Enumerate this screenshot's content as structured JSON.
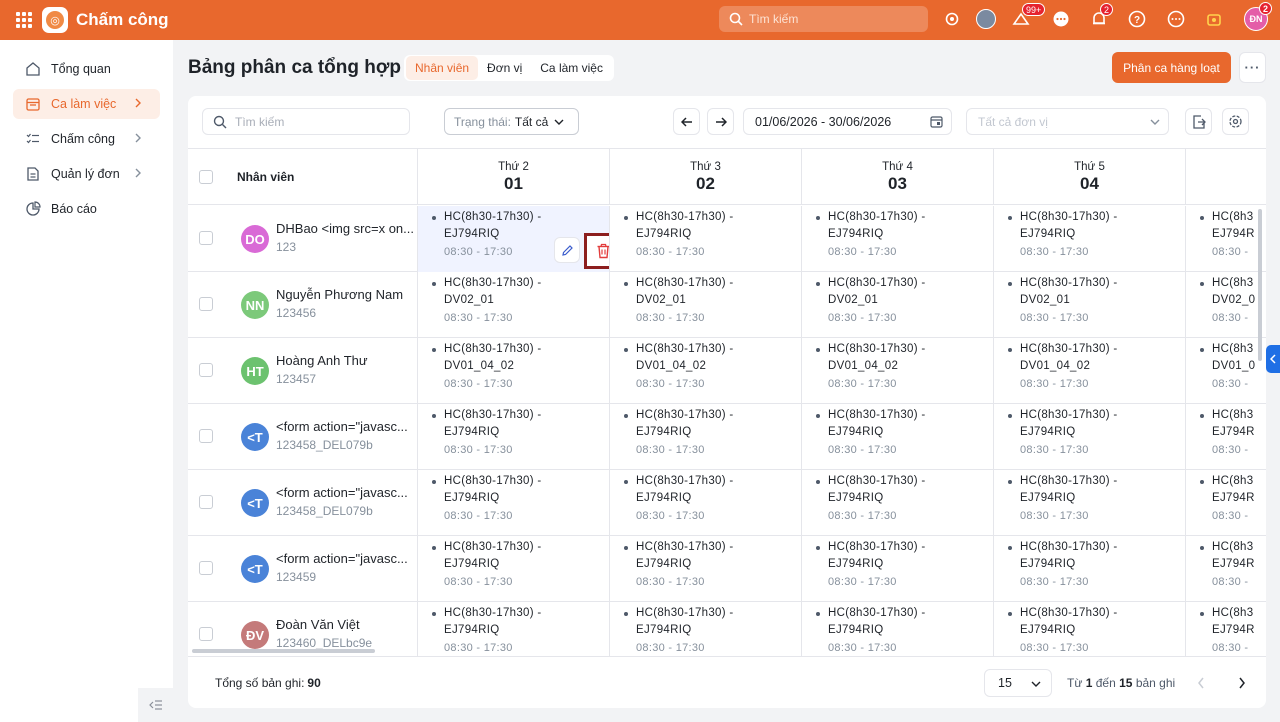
{
  "app": {
    "title": "Chấm công",
    "search_placeholder": "Tìm kiếm",
    "user_initials": "ĐN",
    "user_badge": "2",
    "notification_badge": "2",
    "task_badge": "99+"
  },
  "sidebar": {
    "items": [
      {
        "label": "Tổng quan",
        "icon": "home-icon"
      },
      {
        "label": "Ca làm việc",
        "icon": "calendar-icon",
        "active": true
      },
      {
        "label": "Chấm công",
        "icon": "checklist-icon"
      },
      {
        "label": "Quản lý đơn",
        "icon": "document-icon"
      },
      {
        "label": "Báo cáo",
        "icon": "pie-chart-icon"
      }
    ]
  },
  "header": {
    "title": "Bảng phân ca tổng hợp",
    "tabs": [
      "Nhân viên",
      "Đơn vị",
      "Ca làm việc"
    ],
    "bulk_button": "Phân ca hàng loạt",
    "more": "···"
  },
  "filters": {
    "search_placeholder": "Tìm kiếm",
    "status_label": "Trạng thái:",
    "status_value": "Tất cả",
    "date_range": "01/06/2026 - 30/06/2026",
    "unit_placeholder": "Tất cả đơn vị"
  },
  "grid": {
    "employee_header": "Nhân viên",
    "days": [
      {
        "dow": "Thứ 2",
        "date": "01"
      },
      {
        "dow": "Thứ 3",
        "date": "02"
      },
      {
        "dow": "Thứ 4",
        "date": "03"
      },
      {
        "dow": "Thứ 5",
        "date": "04"
      },
      {
        "dow": "",
        "date": ""
      }
    ],
    "rows": [
      {
        "initials": "DO",
        "color": "#d96ad6",
        "name": "DHBao <img src=x on...",
        "code": "123",
        "shift": "HC(8h30-17h30) -",
        "shift_code": "EJ794RIQ",
        "time": "08:30 - 17:30",
        "partial": "HC(8h3",
        "partial_code": "EJ794R",
        "partial_time": "08:30 -"
      },
      {
        "initials": "NN",
        "color": "#7cc97a",
        "name": "Nguyễn Phương Nam",
        "code": "123456",
        "shift": "HC(8h30-17h30) -",
        "shift_code": "DV02_01",
        "time": "08:30 - 17:30",
        "partial": "HC(8h3",
        "partial_code": "DV02_0",
        "partial_time": "08:30 -"
      },
      {
        "initials": "HT",
        "color": "#6cc26f",
        "name": "Hoàng Anh Thư",
        "code": "123457",
        "shift": "HC(8h30-17h30) -",
        "shift_code": "DV01_04_02",
        "time": "08:30 - 17:30",
        "partial": "HC(8h3",
        "partial_code": "DV01_0",
        "partial_time": "08:30 -"
      },
      {
        "initials": "<T",
        "color": "#4a83d8",
        "name": "<form action=\"javasc...",
        "code": "123458_DEL079b",
        "shift": "HC(8h30-17h30) -",
        "shift_code": "EJ794RIQ",
        "time": "08:30 - 17:30",
        "partial": "HC(8h3",
        "partial_code": "EJ794R",
        "partial_time": "08:30 -"
      },
      {
        "initials": "<T",
        "color": "#4a83d8",
        "name": "<form action=\"javasc...",
        "code": "123458_DEL079b",
        "shift": "HC(8h30-17h30) -",
        "shift_code": "EJ794RIQ",
        "time": "08:30 - 17:30",
        "partial": "HC(8h3",
        "partial_code": "EJ794R",
        "partial_time": "08:30 -"
      },
      {
        "initials": "<T",
        "color": "#4a83d8",
        "name": "<form action=\"javasc...",
        "code": "123459",
        "shift": "HC(8h30-17h30) -",
        "shift_code": "EJ794RIQ",
        "time": "08:30 - 17:30",
        "partial": "HC(8h3",
        "partial_code": "EJ794R",
        "partial_time": "08:30 -"
      },
      {
        "initials": "ĐV",
        "color": "#c47a7a",
        "name": "Đoàn Văn Việt",
        "code": "123460_DELbc9e",
        "shift": "HC(8h30-17h30) -",
        "shift_code": "EJ794RIQ",
        "time": "08:30 - 17:30",
        "partial": "HC(8h3",
        "partial_code": "EJ794R",
        "partial_time": "08:30 -"
      }
    ]
  },
  "footer": {
    "total_label": "Tổng số bản ghi:",
    "total_value": "90",
    "page_size": "15",
    "range_from_label": "Từ",
    "range_from": "1",
    "range_to_label": "đến",
    "range_to": "15",
    "range_suffix": "bản ghi"
  },
  "colors": {
    "brand": "#e8682d",
    "highlight_cell": "#f0f3ff",
    "delete_outline": "#8c1e1e"
  }
}
